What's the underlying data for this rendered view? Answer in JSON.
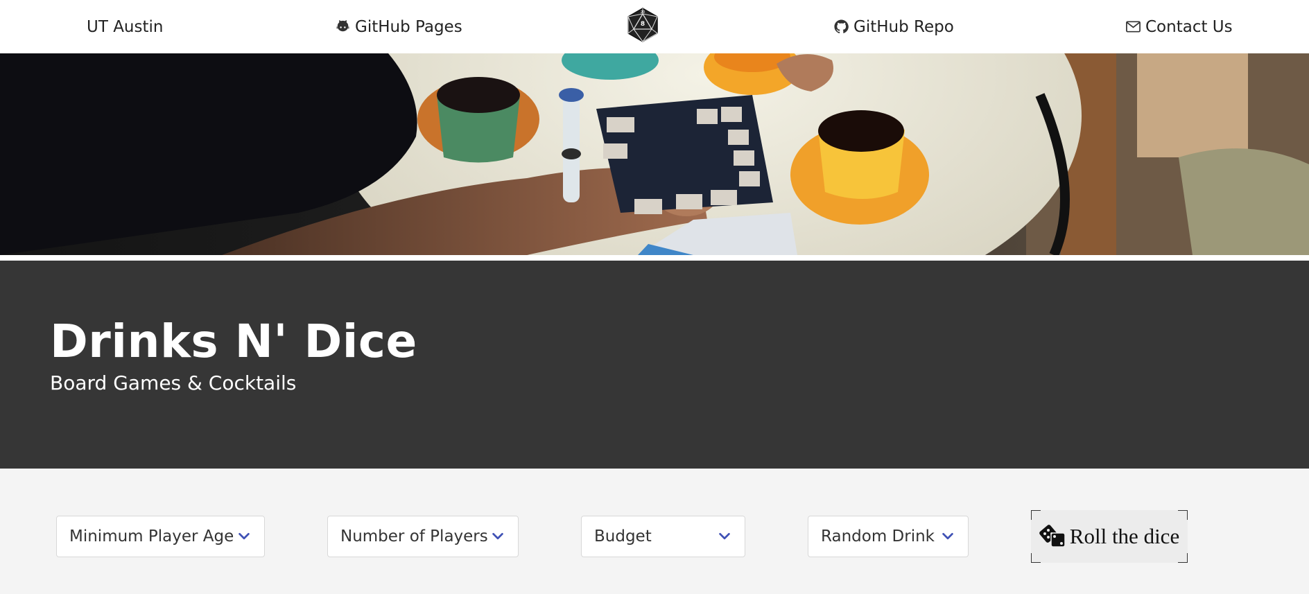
{
  "nav": {
    "ut_label": "UT Austin",
    "pages_label": "GitHub Pages",
    "pages_icon": "github-octocat-icon",
    "logo_icon": "d20-dice-icon",
    "repo_label": "GitHub Repo",
    "repo_icon": "github-icon",
    "contact_label": "Contact Us",
    "contact_icon": "envelope-icon"
  },
  "hero": {
    "image": "people-playing-board-game-with-coffee-cups"
  },
  "banner": {
    "title": "Drinks N' Dice",
    "subtitle": "Board Games & Cocktails"
  },
  "filters": {
    "age": "Minimum Player Age",
    "players": "Number of Players",
    "budget": "Budget",
    "drink": "Random Drink",
    "roll_label": "Roll the dice",
    "roll_icon": "dice-icon"
  },
  "colors": {
    "banner_bg": "#363636",
    "page_bg": "#f4f4f4",
    "chevron": "#3f51b5"
  }
}
